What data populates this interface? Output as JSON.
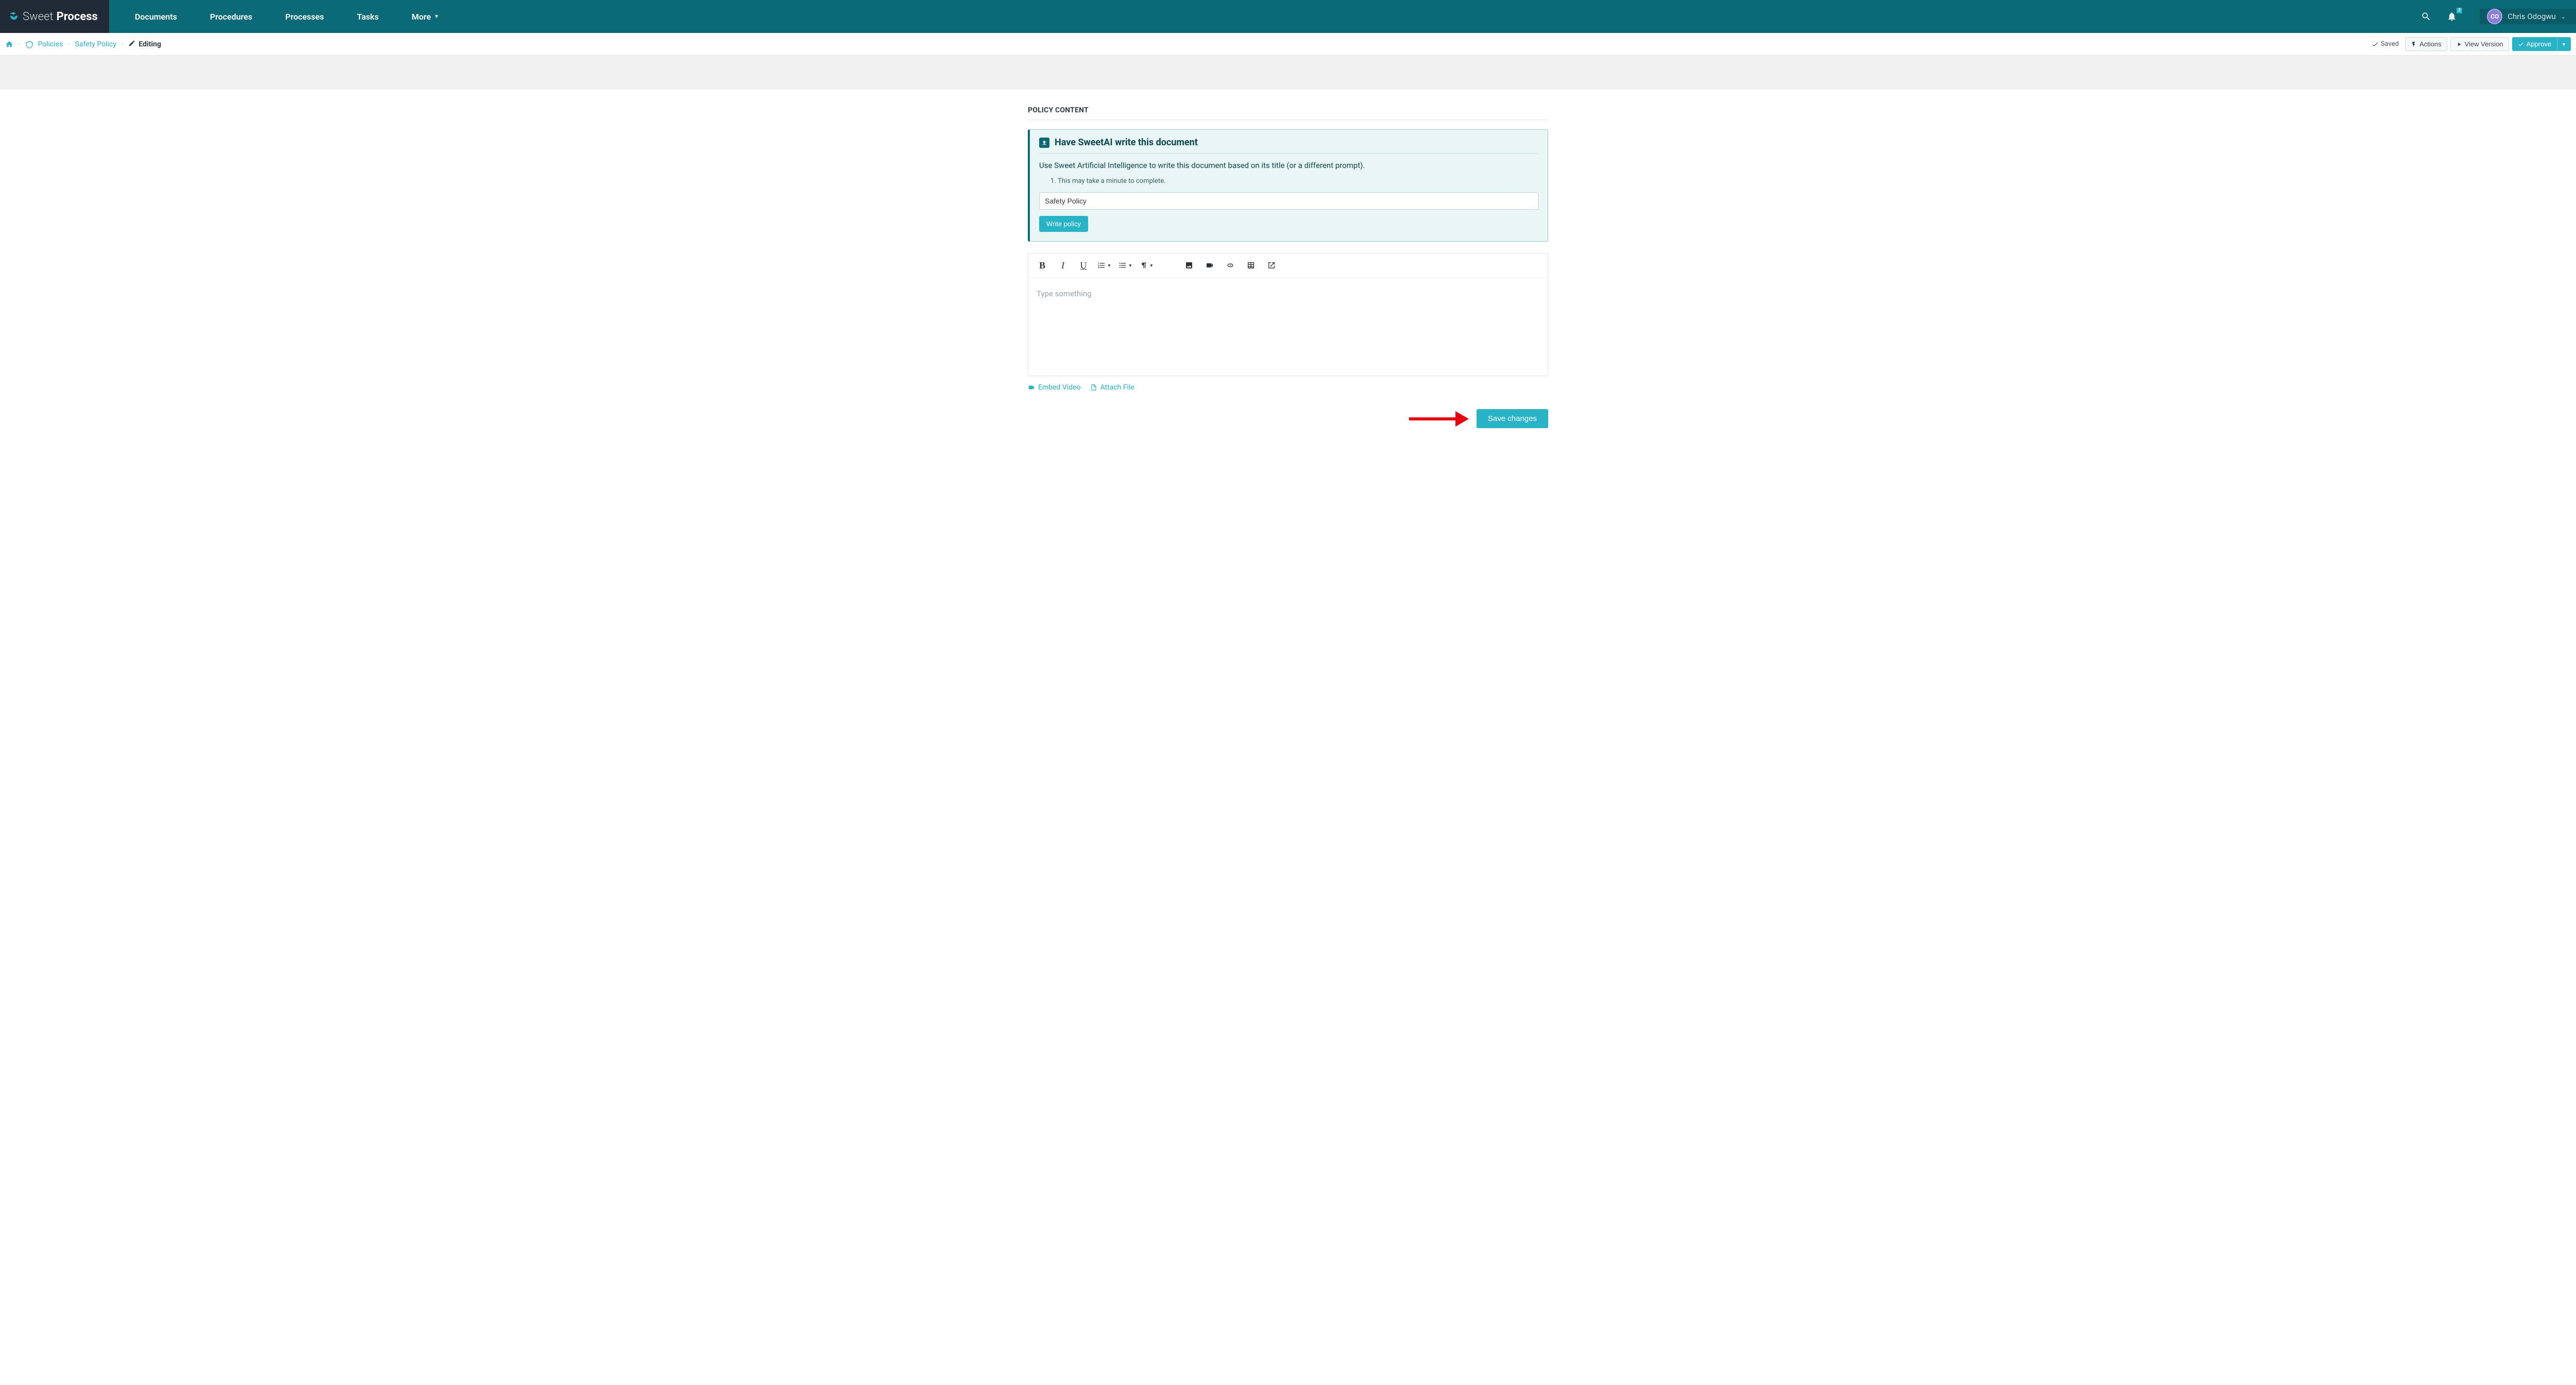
{
  "brand": {
    "thin": "Sweet",
    "bold": "Process"
  },
  "nav": {
    "documents": "Documents",
    "procedures": "Procedures",
    "processes": "Processes",
    "tasks": "Tasks",
    "more": "More"
  },
  "notifications": {
    "count": "2"
  },
  "user": {
    "initials": "CO",
    "name": "Chris Odogwu"
  },
  "breadcrumb": {
    "policies": "Policies",
    "policy_name": "Safety Policy",
    "editing": "Editing"
  },
  "subbar": {
    "saved": "Saved",
    "actions": "Actions",
    "view_version": "View Version",
    "approve": "Approve"
  },
  "section_title": "POLICY CONTENT",
  "ai": {
    "heading": "Have SweetAI write this document",
    "description": "Use Sweet Artificial Intelligence to write this document based on its title (or a different prompt).",
    "note1": "This may take a minute to complete.",
    "input_value": "Safety Policy",
    "button": "Write policy"
  },
  "editor": {
    "placeholder": "Type something"
  },
  "under_links": {
    "embed_video": "Embed Video",
    "attach_file": "Attach File"
  },
  "save_button": "Save changes"
}
